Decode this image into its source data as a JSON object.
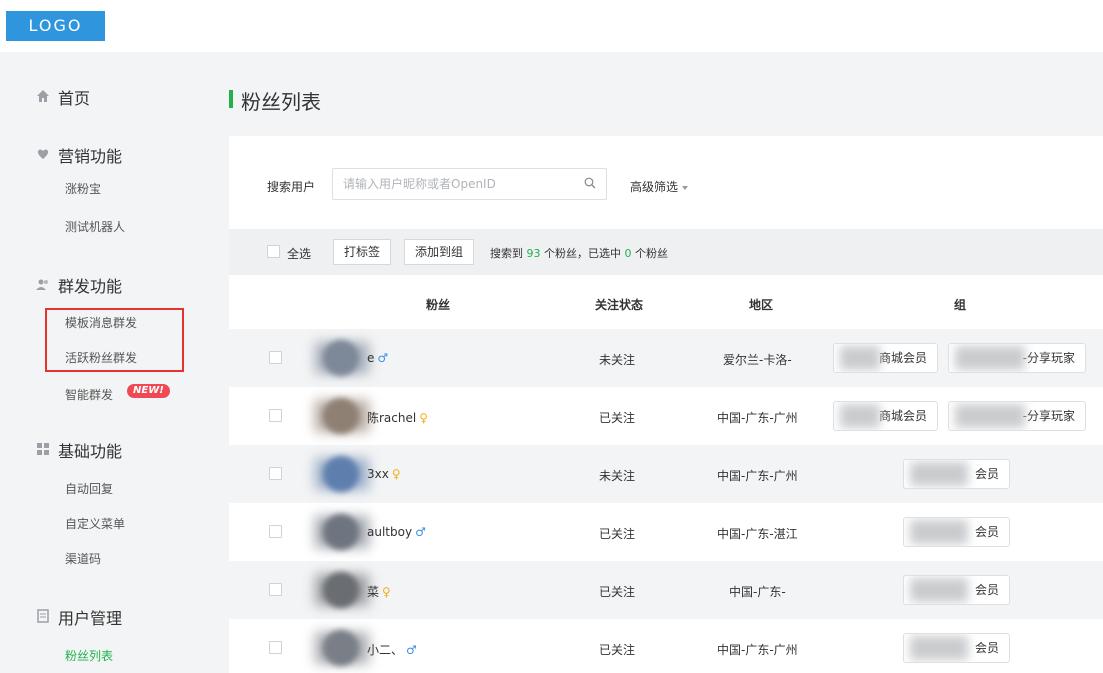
{
  "header": {
    "logo": "LOGO"
  },
  "sidebar": {
    "sections": [
      {
        "title": "首页",
        "icon": "home-icon",
        "items": []
      },
      {
        "title": "营销功能",
        "icon": "marketing-icon",
        "items": [
          "涨粉宝",
          "测试机器人"
        ]
      },
      {
        "title": "群发功能",
        "icon": "users-icon",
        "items": [
          "模板消息群发",
          "活跃粉丝群发",
          "智能群发"
        ],
        "badge": "NEW!"
      },
      {
        "title": "基础功能",
        "icon": "grid-icon",
        "items": [
          "自动回复",
          "自定义菜单",
          "渠道码"
        ]
      },
      {
        "title": "用户管理",
        "icon": "document-icon",
        "items": [
          "粉丝列表"
        ]
      }
    ]
  },
  "main": {
    "title": "粉丝列表",
    "search": {
      "label": "搜索用户",
      "placeholder": "请输入用户昵称或者OpenID",
      "advanced": "高级筛选"
    },
    "toolbar": {
      "select_all": "全选",
      "tag_button": "打标签",
      "add_group_button": "添加到组",
      "summary_prefix": "搜索到",
      "found_count": "93",
      "summary_mid": "个粉丝，已选中",
      "selected_count": "0",
      "summary_suffix": "个粉丝"
    },
    "columns": [
      "粉丝",
      "关注状态",
      "地区",
      "组"
    ],
    "rows": [
      {
        "name": "e",
        "gender": "♂",
        "status": "未关注",
        "region": "爱尔兰-卡洛-",
        "groups": [
          "商城会员",
          "-分享玩家"
        ]
      },
      {
        "name": "陈rachel",
        "gender": "♀",
        "status": "已关注",
        "region": "中国-广东-广州",
        "groups": [
          "商城会员",
          "-分享玩家"
        ]
      },
      {
        "name": "3xx",
        "gender": "♀",
        "status": "未关注",
        "region": "中国-广东-广州",
        "groups": [
          "会员"
        ]
      },
      {
        "name": "aultboy",
        "gender": "♂",
        "status": "已关注",
        "region": "中国-广东-湛江",
        "groups": [
          "会员"
        ]
      },
      {
        "name": "菜",
        "gender": "♀",
        "status": "已关注",
        "region": "中国-广东-",
        "groups": [
          "会员"
        ]
      },
      {
        "name": "小二、",
        "gender": "♂",
        "status": "已关注",
        "region": "中国-广东-广州",
        "groups": [
          "会员"
        ]
      }
    ]
  },
  "colors": {
    "accent": "#22b14c",
    "logo_bg": "#2f95dd",
    "highlight": "#e5342f",
    "male": "#3a8ee6",
    "female": "#f2b01e"
  }
}
